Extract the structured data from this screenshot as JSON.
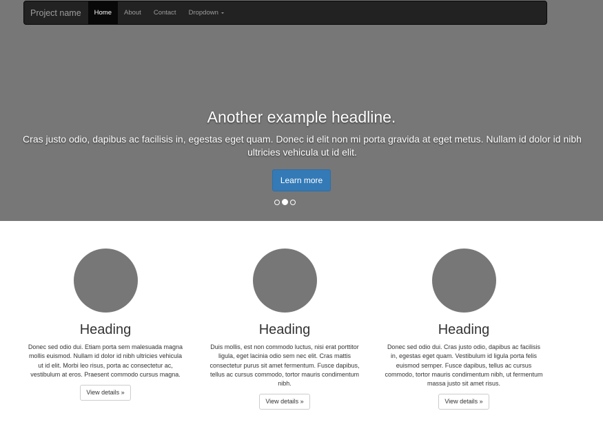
{
  "navbar": {
    "brand": "Project name",
    "items": [
      {
        "label": "Home",
        "active": true
      },
      {
        "label": "About"
      },
      {
        "label": "Contact"
      },
      {
        "label": "Dropdown"
      }
    ]
  },
  "carousel": {
    "headline": "Another example headline.",
    "text": "Cras justo odio, dapibus ac facilisis in, egestas eget quam. Donec id elit non mi porta gravida at eget metus. Nullam id dolor id nibh ultricies vehicula ut id elit.",
    "button": "Learn more",
    "active_slide": 2,
    "slide_count": 3
  },
  "features": [
    {
      "heading": "Heading",
      "text": "Donec sed odio dui. Etiam porta sem malesuada magna mollis euismod. Nullam id dolor id nibh ultricies vehicula ut id elit. Morbi leo risus, porta ac consectetur ac, vestibulum at eros. Praesent commodo cursus magna.",
      "button": "View details »"
    },
    {
      "heading": "Heading",
      "text": "Duis mollis, est non commodo luctus, nisi erat porttitor ligula, eget lacinia odio sem nec elit. Cras mattis consectetur purus sit amet fermentum. Fusce dapibus, tellus ac cursus commodo, tortor mauris condimentum nibh.",
      "button": "View details »"
    },
    {
      "heading": "Heading",
      "text": "Donec sed odio dui. Cras justo odio, dapibus ac facilisis in, egestas eget quam. Vestibulum id ligula porta felis euismod semper. Fusce dapibus, tellus ac cursus commodo, tortor mauris condimentum nibh, ut fermentum massa justo sit amet risus.",
      "button": "View details »"
    }
  ],
  "colors": {
    "navbar_bg": "#222222",
    "carousel_bg": "#777777",
    "primary": "#337ab7"
  }
}
